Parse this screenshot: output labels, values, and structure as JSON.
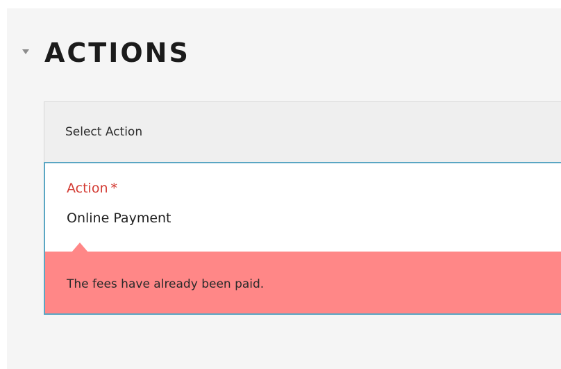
{
  "section": {
    "title": "ACTIONS",
    "collapse_icon": "caret-down-icon"
  },
  "action_card": {
    "header": "Select Action",
    "field": {
      "label": "Action",
      "required_mark": "*",
      "value": "Online Payment"
    },
    "error": {
      "message": "The fees have already been paid."
    }
  },
  "colors": {
    "page_background": "#f5f5f5",
    "title": "#1b1b1b",
    "header_background": "#efefef",
    "focus_border": "#5aa6c3",
    "required_label": "#d33a32",
    "error_background": "#ff8787"
  }
}
